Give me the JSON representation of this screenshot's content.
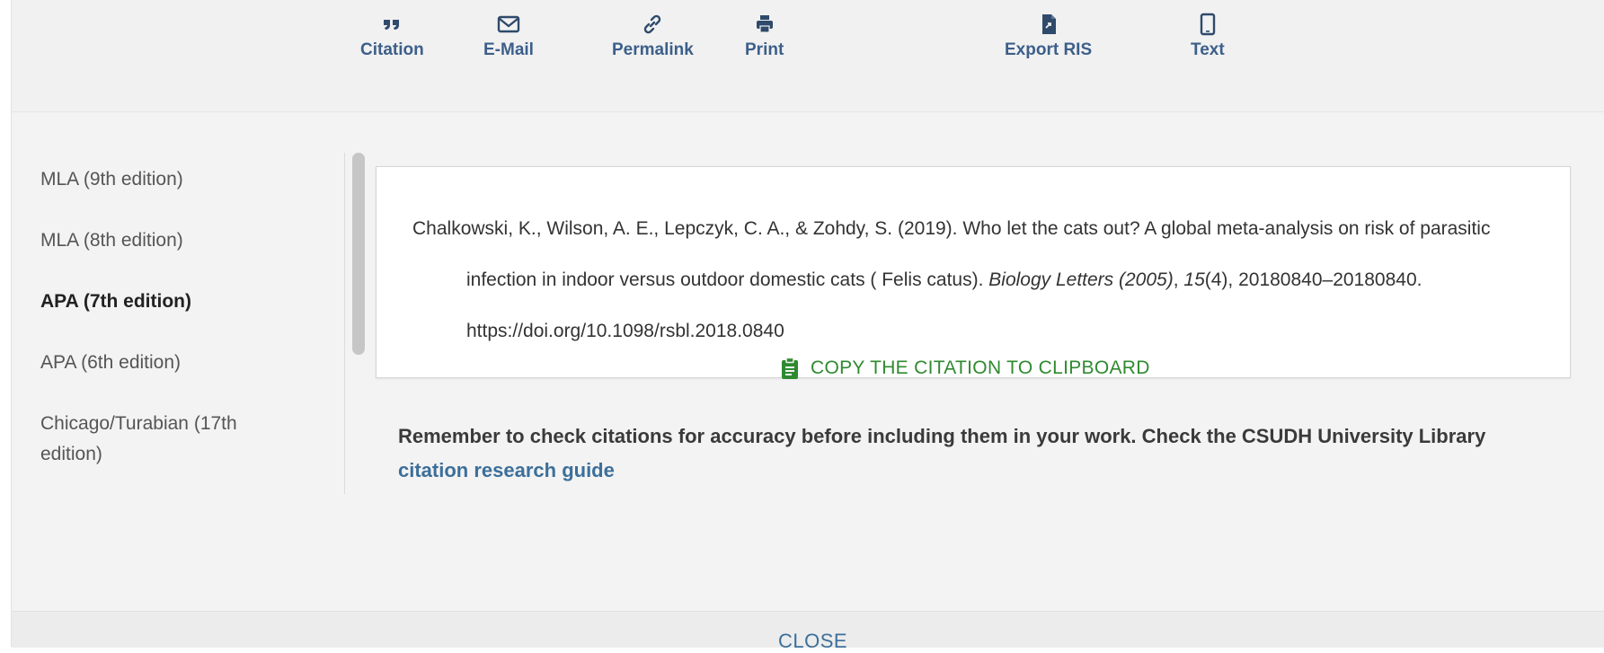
{
  "toolbar": {
    "items": [
      {
        "label": "Citation",
        "icon": "quote-icon"
      },
      {
        "label": "E-Mail",
        "icon": "envelope-icon"
      },
      {
        "label": "Permalink",
        "icon": "link-icon"
      },
      {
        "label": "Print",
        "icon": "printer-icon"
      },
      {
        "label": "Export RIS",
        "icon": "file-export-icon"
      },
      {
        "label": "Text",
        "icon": "mobile-phone-icon"
      }
    ]
  },
  "styles": {
    "items": [
      {
        "label": "MLA (9th edition)"
      },
      {
        "label": "MLA (8th edition)"
      },
      {
        "label": "APA (7th edition)"
      },
      {
        "label": "APA (6th edition)"
      },
      {
        "label": "Chicago/Turabian (17th edition)"
      }
    ],
    "selected": "APA (7th edition)"
  },
  "citation": {
    "authors_year": "Chalkowski, K., Wilson, A. E., Lepczyk, C. A., & Zohdy, S. (2019). Who let the cats out? A global meta-analysis on risk of parasitic infection in indoor versus outdoor domestic cats ( Felis catus). ",
    "journal": "Biology Letters (2005)",
    "sep1": ", ",
    "volume": "15",
    "issue_pages": "(4), 20180840–20180840. https://doi.org/10.1098/rsbl.2018.0840"
  },
  "copy": {
    "label": "COPY THE CITATION TO CLIPBOARD",
    "icon": "clipboard-icon",
    "color": "#2f8a2f"
  },
  "reminder": {
    "text": "Remember to check citations for accuracy before including them in your work. Check the CSUDH University Library ",
    "link_label": "citation research guide"
  },
  "footer": {
    "close_label": "CLOSE"
  },
  "colors": {
    "accent": "#3c5f8a",
    "link": "#3c6f9a",
    "success": "#2f8a2f"
  }
}
